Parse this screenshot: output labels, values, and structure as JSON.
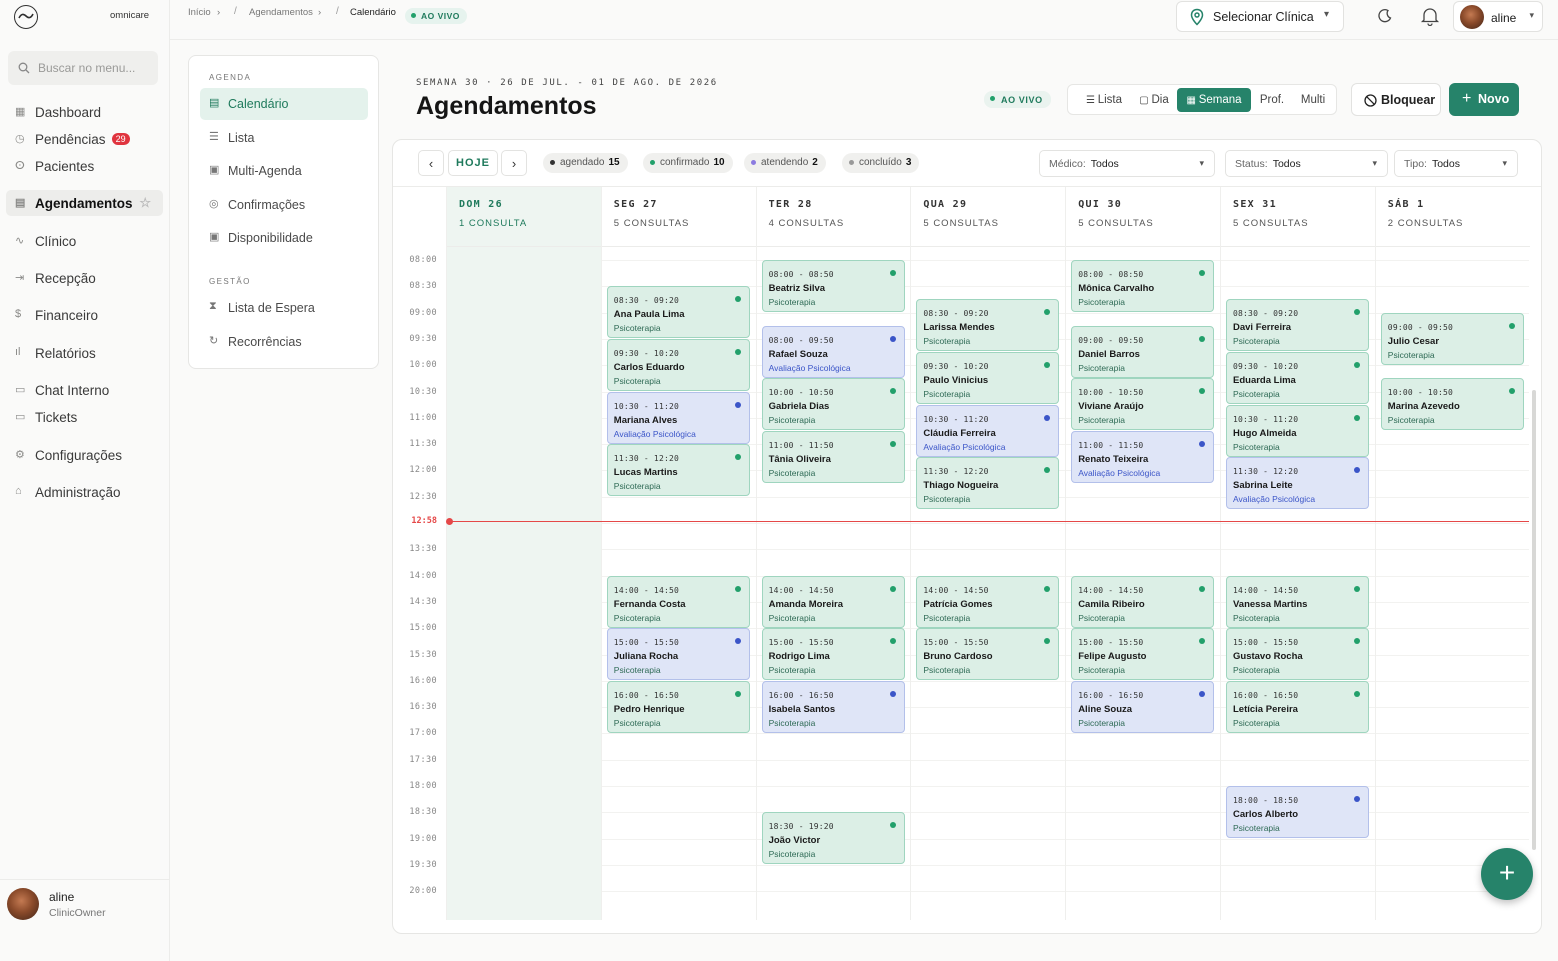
{
  "app": {
    "name": "omnicare"
  },
  "sidebar": {
    "search_placeholder": "Buscar no menu...",
    "items": [
      {
        "label": "Dashboard",
        "icon": "grid-icon"
      },
      {
        "label": "Pendências",
        "icon": "clock-icon",
        "badge": "29"
      },
      {
        "label": "Pacientes",
        "icon": "users-icon"
      },
      {
        "label": "Agendamentos",
        "icon": "calendar-icon",
        "active": true
      },
      {
        "label": "Clínico",
        "icon": "activity-icon"
      },
      {
        "label": "Recepção",
        "icon": "login-icon"
      },
      {
        "label": "Financeiro",
        "icon": "dollar-icon"
      },
      {
        "label": "Relatórios",
        "icon": "bar-chart-icon"
      },
      {
        "label": "Chat Interno",
        "icon": "chat-icon"
      },
      {
        "label": "Tickets",
        "icon": "ticket-icon"
      },
      {
        "label": "Configurações",
        "icon": "gear-icon"
      },
      {
        "label": "Administração",
        "icon": "home-icon"
      }
    ],
    "user": {
      "name": "aline",
      "role": "ClinicOwner"
    }
  },
  "topbar": {
    "breadcrumb": [
      "Início",
      "Agendamentos",
      "Calendário"
    ],
    "live": "AO VIVO",
    "clinic_select": "Selecionar Clínica",
    "user": "aline"
  },
  "subnav": {
    "section1": "AGENDA",
    "section1_items": [
      {
        "label": "Calendário",
        "active": true
      },
      {
        "label": "Lista"
      },
      {
        "label": "Multi-Agenda"
      },
      {
        "label": "Confirmações"
      },
      {
        "label": "Disponibilidade"
      }
    ],
    "section2": "GESTÃO",
    "section2_items": [
      {
        "label": "Lista de Espera"
      },
      {
        "label": "Recorrências"
      }
    ]
  },
  "page": {
    "week_label": "SEMANA 30 · 26 DE JUL. - 01 DE AGO. DE 2026",
    "title": "Agendamentos",
    "live": "AO VIVO",
    "views": [
      "Lista",
      "Dia",
      "Semana",
      "Prof.",
      "Multi"
    ],
    "active_view": "Semana",
    "block_button": "Bloquear",
    "new_button": "Novo"
  },
  "toolbar": {
    "today": "HOJE",
    "counts": [
      {
        "label": "agendado",
        "value": "15",
        "color": "#333333"
      },
      {
        "label": "confirmado",
        "value": "10",
        "color": "#22a06b"
      },
      {
        "label": "atendendo",
        "value": "2",
        "color": "#8b7be0"
      },
      {
        "label": "concluído",
        "value": "3",
        "color": "#999999"
      }
    ],
    "filters": [
      {
        "label": "Médico:",
        "value": "Todos"
      },
      {
        "label": "Status:",
        "value": "Todos"
      },
      {
        "label": "Tipo:",
        "value": "Todos"
      }
    ]
  },
  "calendar": {
    "times": [
      "08:00",
      "08:30",
      "09:00",
      "09:30",
      "10:00",
      "10:30",
      "11:00",
      "11:30",
      "12:00",
      "12:30",
      "13:00",
      "13:30",
      "14:00",
      "14:30",
      "15:00",
      "15:30",
      "16:00",
      "16:30",
      "17:00",
      "17:30",
      "18:00",
      "18:30",
      "19:00",
      "19:30",
      "20:00"
    ],
    "now": "12:58",
    "days": [
      {
        "name": "DOM 26",
        "count": "1 CONSULTA",
        "today": true,
        "appts": []
      },
      {
        "name": "SEG 27",
        "count": "5 CONSULTAS",
        "appts": [
          {
            "time": "08:30 - 09:20",
            "patient": "Ana Paula Lima",
            "type": "Psicoterapia",
            "start": "08:30",
            "status": "confirmado"
          },
          {
            "time": "09:30 - 10:20",
            "patient": "Carlos Eduardo",
            "type": "Psicoterapia",
            "start": "09:30",
            "status": "confirmado"
          },
          {
            "time": "10:30 - 11:20",
            "patient": "Mariana Alves",
            "type": "Avaliação Psicológica",
            "start": "10:30",
            "status": "agendado"
          },
          {
            "time": "11:30 - 12:20",
            "patient": "Lucas Martins",
            "type": "Psicoterapia",
            "start": "11:30",
            "status": "confirmado"
          },
          {
            "time": "14:00 - 14:50",
            "patient": "Fernanda Costa",
            "type": "Psicoterapia",
            "start": "14:00",
            "status": "confirmado"
          },
          {
            "time": "15:00 - 15:50",
            "patient": "Juliana Rocha",
            "type": "Psicoterapia",
            "start": "15:00",
            "status": "agendado"
          },
          {
            "time": "16:00 - 16:50",
            "patient": "Pedro Henrique",
            "type": "Psicoterapia",
            "start": "16:00",
            "status": "confirmado"
          }
        ]
      },
      {
        "name": "TER 28",
        "count": "4 CONSULTAS",
        "appts": [
          {
            "time": "08:00 - 08:50",
            "patient": "Beatriz Silva",
            "type": "Psicoterapia",
            "start": "08:00",
            "status": "confirmado"
          },
          {
            "time": "08:00 - 09:50",
            "patient": "Rafael Souza",
            "type": "Avaliação Psicológica",
            "start": "09:15",
            "status": "agendado"
          },
          {
            "time": "10:00 - 10:50",
            "patient": "Gabriela Dias",
            "type": "Psicoterapia",
            "start": "10:15",
            "status": "confirmado"
          },
          {
            "time": "11:00 - 11:50",
            "patient": "Tânia Oliveira",
            "type": "Psicoterapia",
            "start": "11:15",
            "status": "confirmado"
          },
          {
            "time": "14:00 - 14:50",
            "patient": "Amanda Moreira",
            "type": "Psicoterapia",
            "start": "14:00",
            "status": "confirmado"
          },
          {
            "time": "15:00 - 15:50",
            "patient": "Rodrigo Lima",
            "type": "Psicoterapia",
            "start": "15:00",
            "status": "confirmado"
          },
          {
            "time": "16:00 - 16:50",
            "patient": "Isabela Santos",
            "type": "Psicoterapia",
            "start": "16:00",
            "status": "agendado"
          },
          {
            "time": "18:30 - 19:20",
            "patient": "João Victor",
            "type": "Psicoterapia",
            "start": "18:30",
            "status": "confirmado"
          }
        ]
      },
      {
        "name": "QUA 29",
        "count": "5 CONSULTAS",
        "appts": [
          {
            "time": "08:30 - 09:20",
            "patient": "Larissa Mendes",
            "type": "Psicoterapia",
            "start": "08:45",
            "status": "confirmado"
          },
          {
            "time": "09:30 - 10:20",
            "patient": "Paulo Vinicius",
            "type": "Psicoterapia",
            "start": "09:45",
            "status": "confirmado"
          },
          {
            "time": "10:30 - 11:20",
            "patient": "Cláudia Ferreira",
            "type": "Avaliação Psicológica",
            "start": "10:45",
            "status": "agendado"
          },
          {
            "time": "11:30 - 12:20",
            "patient": "Thiago Nogueira",
            "type": "Psicoterapia",
            "start": "11:45",
            "status": "confirmado"
          },
          {
            "time": "14:00 - 14:50",
            "patient": "Patrícia Gomes",
            "type": "Psicoterapia",
            "start": "14:00",
            "status": "confirmado"
          },
          {
            "time": "15:00 - 15:50",
            "patient": "Bruno Cardoso",
            "type": "Psicoterapia",
            "start": "15:00",
            "status": "confirmado"
          }
        ]
      },
      {
        "name": "QUI 30",
        "count": "5 CONSULTAS",
        "appts": [
          {
            "time": "08:00 - 08:50",
            "patient": "Mônica Carvalho",
            "type": "Psicoterapia",
            "start": "08:00",
            "status": "confirmado"
          },
          {
            "time": "09:00 - 09:50",
            "patient": "Daniel Barros",
            "type": "Psicoterapia",
            "start": "09:15",
            "status": "confirmado"
          },
          {
            "time": "10:00 - 10:50",
            "patient": "Viviane Araújo",
            "type": "Psicoterapia",
            "start": "10:15",
            "status": "confirmado"
          },
          {
            "time": "11:00 - 11:50",
            "patient": "Renato Teixeira",
            "type": "Avaliação Psicológica",
            "start": "11:15",
            "status": "agendado"
          },
          {
            "time": "14:00 - 14:50",
            "patient": "Camila Ribeiro",
            "type": "Psicoterapia",
            "start": "14:00",
            "status": "confirmado"
          },
          {
            "time": "15:00 - 15:50",
            "patient": "Felipe Augusto",
            "type": "Psicoterapia",
            "start": "15:00",
            "status": "confirmado"
          },
          {
            "time": "16:00 - 16:50",
            "patient": "Aline Souza",
            "type": "Psicoterapia",
            "start": "16:00",
            "status": "agendado"
          }
        ]
      },
      {
        "name": "SEX 31",
        "count": "5 CONSULTAS",
        "appts": [
          {
            "time": "08:30 - 09:20",
            "patient": "Davi Ferreira",
            "type": "Psicoterapia",
            "start": "08:45",
            "status": "confirmado"
          },
          {
            "time": "09:30 - 10:20",
            "patient": "Eduarda Lima",
            "type": "Psicoterapia",
            "start": "09:45",
            "status": "confirmado"
          },
          {
            "time": "10:30 - 11:20",
            "patient": "Hugo Almeida",
            "type": "Psicoterapia",
            "start": "10:45",
            "status": "confirmado"
          },
          {
            "time": "11:30 - 12:20",
            "patient": "Sabrina Leite",
            "type": "Avaliação Psicológica",
            "start": "11:45",
            "status": "agendado"
          },
          {
            "time": "14:00 - 14:50",
            "patient": "Vanessa Martins",
            "type": "Psicoterapia",
            "start": "14:00",
            "status": "confirmado"
          },
          {
            "time": "15:00 - 15:50",
            "patient": "Gustavo Rocha",
            "type": "Psicoterapia",
            "start": "15:00",
            "status": "confirmado"
          },
          {
            "time": "16:00 - 16:50",
            "patient": "Letícia Pereira",
            "type": "Psicoterapia",
            "start": "16:00",
            "status": "confirmado"
          },
          {
            "time": "18:00 - 18:50",
            "patient": "Carlos Alberto",
            "type": "Psicoterapia",
            "start": "18:00",
            "status": "agendado"
          }
        ]
      },
      {
        "name": "SÁB 1",
        "count": "2 CONSULTAS",
        "appts": [
          {
            "time": "09:00 - 09:50",
            "patient": "Julio Cesar",
            "type": "Psicoterapia",
            "start": "09:00",
            "status": "confirmado"
          },
          {
            "time": "10:00 - 10:50",
            "patient": "Marina Azevedo",
            "type": "Psicoterapia",
            "start": "10:15",
            "status": "confirmado"
          }
        ]
      }
    ]
  },
  "fab": "+"
}
